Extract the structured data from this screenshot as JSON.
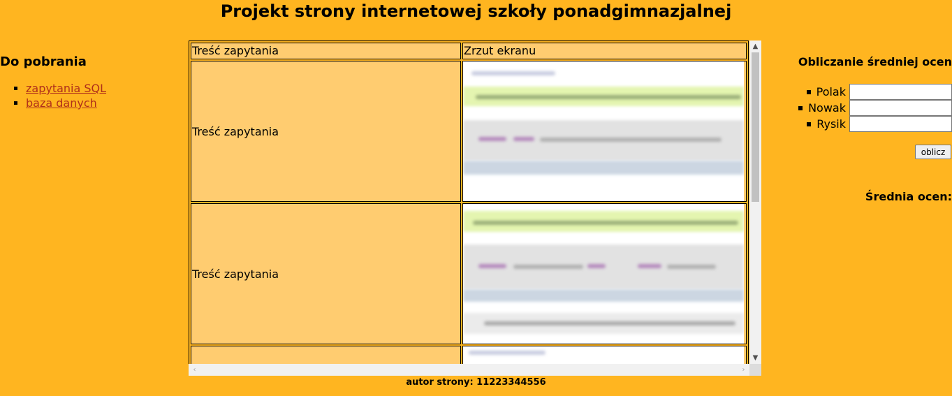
{
  "header": {
    "title": "Projekt strony internetowej szkoły ponadgimnazjalnej"
  },
  "left": {
    "heading": "Do pobrania",
    "links": [
      {
        "label": "zapytania SQL"
      },
      {
        "label": "baza danych"
      }
    ]
  },
  "table": {
    "headers": [
      "Treść zapytania",
      "Zrzut ekranu"
    ],
    "rows": [
      {
        "query": "Treść zapytania"
      },
      {
        "query": "Treść zapytania"
      },
      {
        "query": ""
      }
    ]
  },
  "right": {
    "heading": "Obliczanie średniej ocen",
    "students": [
      {
        "name": "Polak",
        "value": ""
      },
      {
        "name": "Nowak",
        "value": ""
      },
      {
        "name": "Rysik",
        "value": ""
      }
    ],
    "button_label": "oblicz",
    "average_label": "Średnia ocen:"
  },
  "footer": {
    "text": "autor strony: 11223344556"
  },
  "colors": {
    "background": "#FFB520",
    "cell": "#FFCC70",
    "link": "#B0301A"
  }
}
